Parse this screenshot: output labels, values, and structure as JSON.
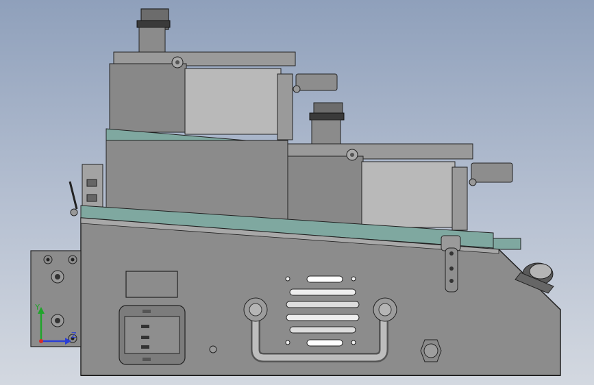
{
  "view": {
    "background_top": "#8fa0bb",
    "background_bottom": "#d3d8e0",
    "body_color": "#8c8c8c",
    "accent_stripe": "#7fa8a0"
  },
  "triad": {
    "y_label": "Y",
    "z_label": "Z",
    "y_color": "#1fa52a",
    "z_color": "#2b3fd6",
    "x_color": "#d62b2b"
  }
}
